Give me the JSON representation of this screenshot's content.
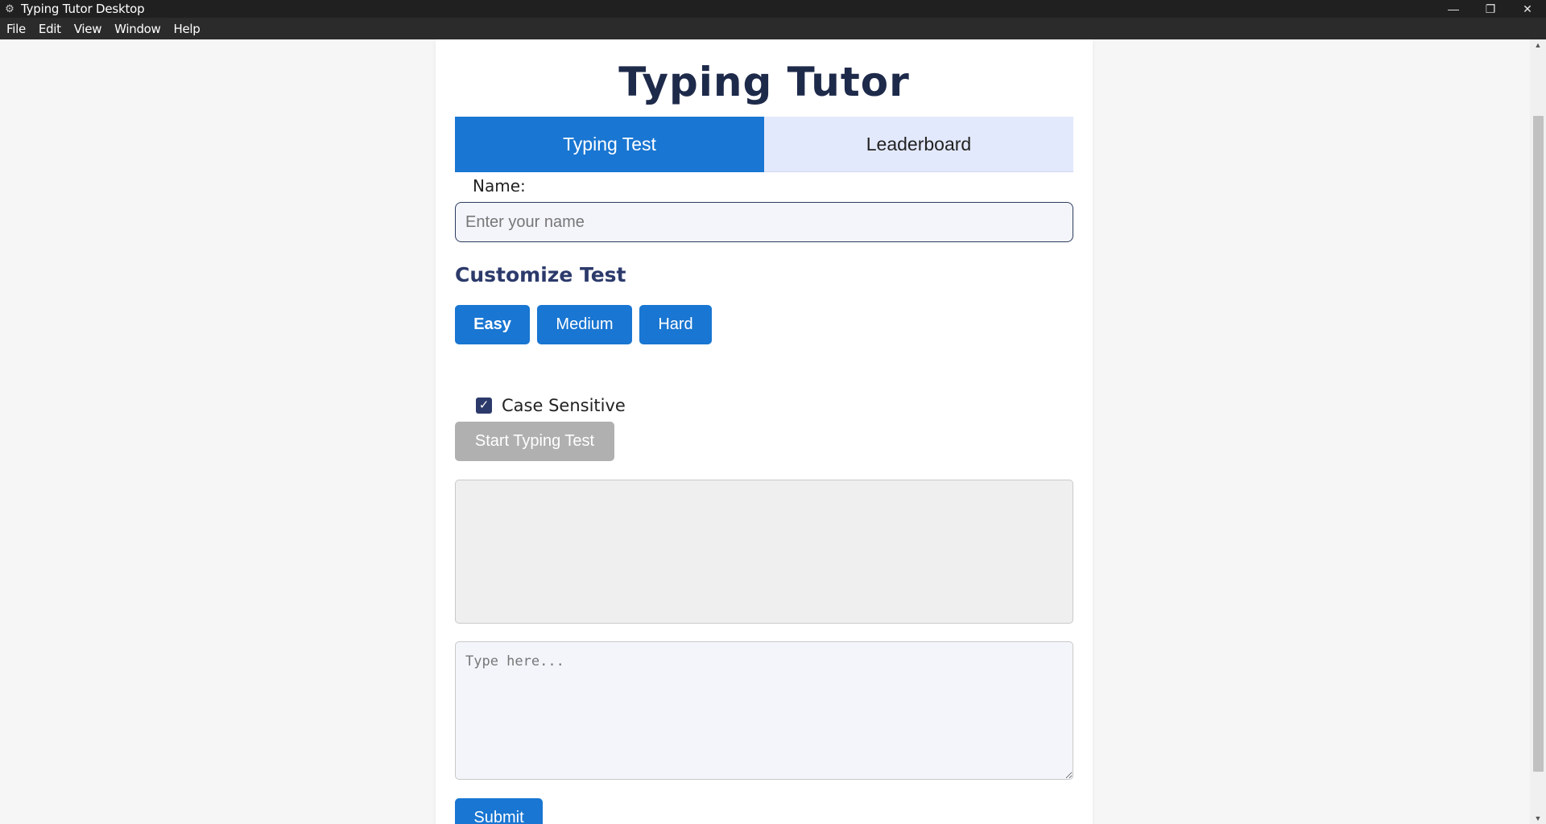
{
  "window": {
    "title": "Typing Tutor Desktop",
    "controls": {
      "minimize": "—",
      "restore": "❐",
      "close": "✕"
    }
  },
  "menu": [
    "File",
    "Edit",
    "View",
    "Window",
    "Help"
  ],
  "app": {
    "title": "Typing Tutor",
    "tabs": [
      {
        "label": "Typing Test",
        "active": true
      },
      {
        "label": "Leaderboard",
        "active": false
      }
    ],
    "name_label": "Name:",
    "name_placeholder": "Enter your name",
    "customize_heading": "Customize Test",
    "difficulty": [
      "Easy",
      "Medium",
      "Hard"
    ],
    "selected_difficulty": "Easy",
    "case_sensitive": {
      "label": "Case Sensitive",
      "checked": true
    },
    "start_button": "Start Typing Test",
    "typing_placeholder": "Type here...",
    "submit_button": "Submit"
  },
  "colors": {
    "accent": "#1976d2",
    "title": "#1e2a4a",
    "heading": "#2c3a6b",
    "inactive_tab": "#e3e9fc",
    "disabled_button": "#b0b0b0"
  }
}
